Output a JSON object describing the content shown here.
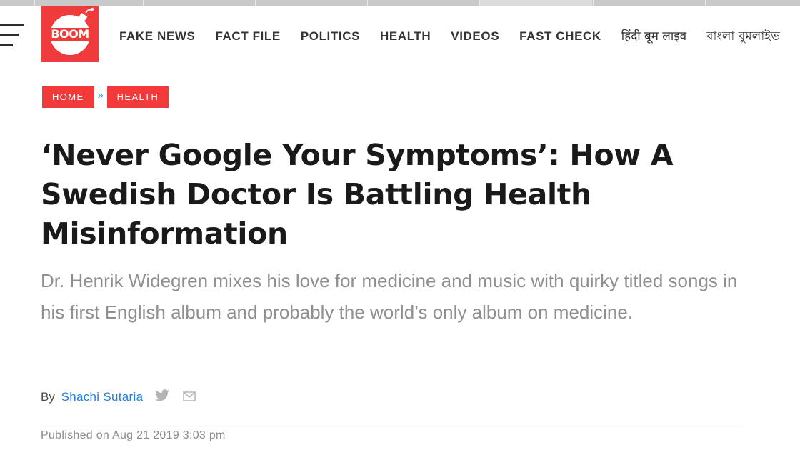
{
  "nav": {
    "logo_text": "BOOM",
    "items": [
      {
        "label": "FAKE NEWS"
      },
      {
        "label": "FACT FILE"
      },
      {
        "label": "POLITICS"
      },
      {
        "label": "HEALTH"
      },
      {
        "label": "VIDEOS"
      },
      {
        "label": "FAST CHECK"
      },
      {
        "label": "हिंदी बूम लाइव"
      },
      {
        "label": "বাংলা বুমলাইভ"
      }
    ]
  },
  "breadcrumb": {
    "items": [
      {
        "label": "HOME"
      },
      {
        "label": "HEALTH"
      }
    ],
    "separator": "»"
  },
  "article": {
    "title": "‘Never Google Your Symptoms’: How A Swedish Doctor Is Battling Health Misinformation",
    "subtitle": "Dr. Henrik Widegren mixes his love for medicine and music with quirky titled songs in his first English album and probably the world’s only album on medicine.",
    "by_label": "By",
    "author": "Shachi Sutaria",
    "published": "Published on Aug 21 2019 3:03 pm"
  },
  "colors": {
    "brand_red": "#ef3b3b",
    "link_blue": "#1e7fe0",
    "icon_gray": "#b5b5b5"
  }
}
